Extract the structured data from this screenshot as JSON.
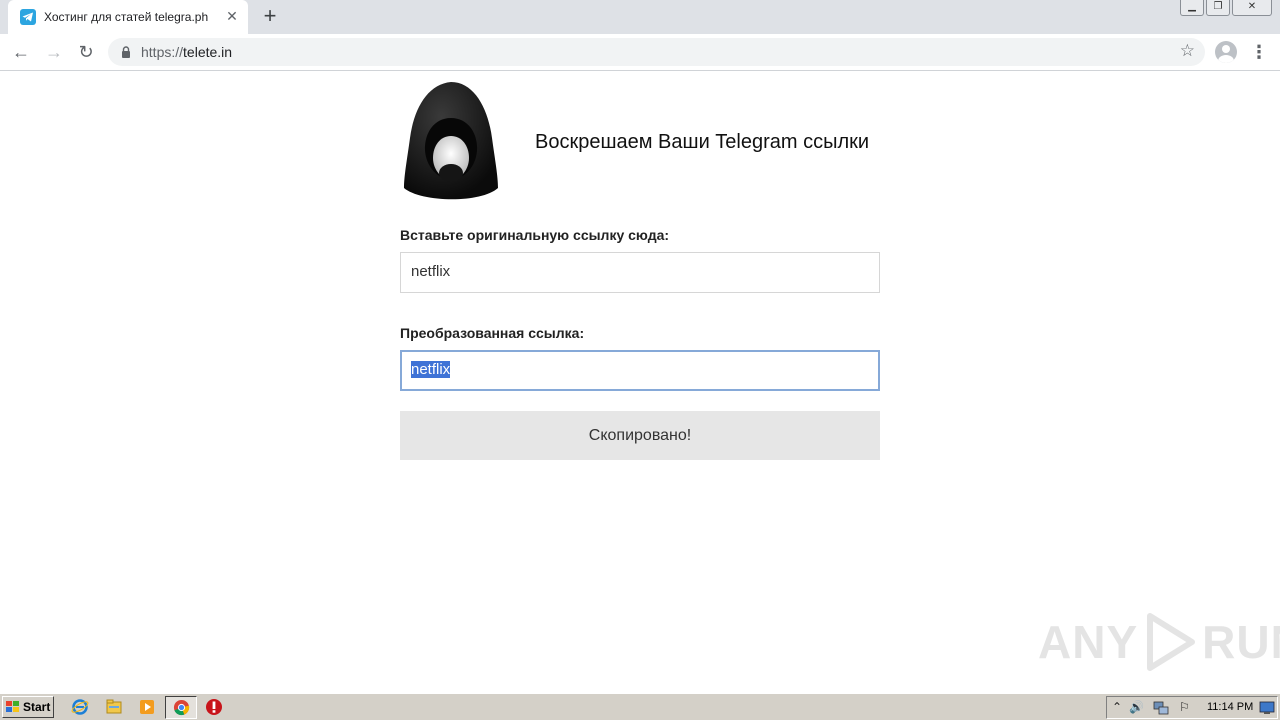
{
  "browser": {
    "tab": {
      "title": "Хостинг для статей telegra.ph",
      "close_glyph": "✕"
    },
    "new_tab_glyph": "+",
    "window_controls": {
      "minimize": "▁",
      "restore": "❐",
      "close": "✕"
    },
    "nav": {
      "back": "←",
      "forward": "→",
      "reload": "↻"
    },
    "address": {
      "scheme": "https://",
      "host": "telete.in"
    },
    "bookmark_glyph": "☆",
    "menu_glyph": "⋮"
  },
  "page": {
    "headline": "Воскрешаем Ваши Telegram ссылки",
    "original_label": "Вставьте оригинальную ссылку сюда:",
    "original_value": "netflix",
    "converted_label": "Преобразованная ссылка:",
    "converted_value": "netflix",
    "copy_button": "Скопировано!",
    "watermark": {
      "left": "ANY",
      "right": "RUN"
    }
  },
  "taskbar": {
    "start_label": "Start",
    "clock": "11:14 PM",
    "tray_glyphs": {
      "expand": "⌃",
      "volume": "🔊",
      "flag": "⚐"
    }
  },
  "colors": {
    "telegram_blue": "#2ca5e0",
    "selection": "#3f73d6",
    "focus_border": "#86a9d8",
    "button_bg": "#e6e6e6"
  }
}
